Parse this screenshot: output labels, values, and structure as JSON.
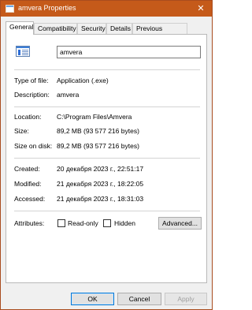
{
  "window": {
    "title": "amvera Properties",
    "close_glyph": "✕"
  },
  "tabs": [
    "General",
    "Compatibility",
    "Security",
    "Details",
    "Previous Versions"
  ],
  "file": {
    "name": "amvera",
    "icon": "application-window-icon"
  },
  "props": {
    "type_label": "Type of file:",
    "type_value": "Application (.exe)",
    "desc_label": "Description:",
    "desc_value": "amvera",
    "location_label": "Location:",
    "location_value": "C:\\Program Files\\Amvera",
    "size_label": "Size:",
    "size_value": "89,2 MB (93 577 216 bytes)",
    "size_disk_label": "Size on disk:",
    "size_disk_value": "89,2 MB (93 577 216 bytes)",
    "created_label": "Created:",
    "created_value": "20 декабря 2023 г., 22:51:17",
    "modified_label": "Modified:",
    "modified_value": "21 декабря 2023 г., 18:22:05",
    "accessed_label": "Accessed:",
    "accessed_value": "21 декабря 2023 г., 18:31:03",
    "attributes_label": "Attributes:",
    "readonly_label": "Read-only",
    "hidden_label": "Hidden",
    "advanced_label": "Advanced..."
  },
  "buttons": {
    "ok": "OK",
    "cancel": "Cancel",
    "apply": "Apply"
  },
  "colors": {
    "titlebar": "#c55a1a",
    "accent": "#0078d7"
  }
}
